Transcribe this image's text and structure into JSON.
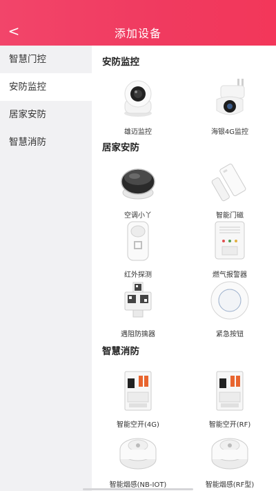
{
  "header": {
    "back_glyph": "<",
    "title": "添加设备"
  },
  "sidebar": {
    "items": [
      {
        "label": "智慧门控"
      },
      {
        "label": "安防监控"
      },
      {
        "label": "居家安防"
      },
      {
        "label": "智慧消防"
      }
    ],
    "active_index": 1
  },
  "sections": [
    {
      "title": "安防监控",
      "devices": [
        {
          "label": "雄迈监控"
        },
        {
          "label": "海银4G监控"
        }
      ]
    },
    {
      "title": "居家安防",
      "devices": [
        {
          "label": "空调小丫"
        },
        {
          "label": "智能门磁"
        },
        {
          "label": "红外探测"
        },
        {
          "label": "燃气报警器"
        },
        {
          "label": "遇阻防擒器"
        },
        {
          "label": "紧急按钮"
        }
      ]
    },
    {
      "title": "智慧消防",
      "devices": [
        {
          "label": "智能空开(4G)"
        },
        {
          "label": "智能空开(RF)"
        },
        {
          "label": "智能烟感(NB-IOT)"
        },
        {
          "label": "智能烟感(RF型)"
        }
      ]
    }
  ],
  "colors": {
    "header_start": "#f2456a",
    "header_end": "#f3375a",
    "sidebar_bg": "#f1f1f3",
    "accent_red": "#ef3b5a"
  }
}
